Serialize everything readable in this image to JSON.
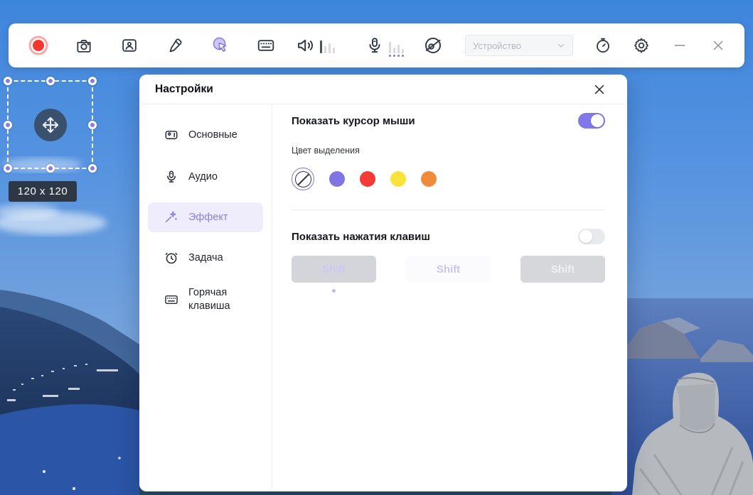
{
  "toolbar": {
    "device_dropdown_value": "Устройство"
  },
  "selection": {
    "size_label": "120 x 120"
  },
  "dialog": {
    "title": "Настройки",
    "sidebar": {
      "items": [
        {
          "label": "Основные"
        },
        {
          "label": "Аудио"
        },
        {
          "label": "Эффект",
          "selected": true
        },
        {
          "label": "Задача"
        },
        {
          "label": "Горячая клавиша"
        }
      ]
    },
    "content": {
      "show_cursor_label": "Показать курсор мыши",
      "show_cursor_enabled": true,
      "highlight_color_label": "Цвет выделения",
      "swatches": [
        {
          "name": "none",
          "selected": true
        },
        {
          "name": "purple",
          "color": "#8075E5"
        },
        {
          "name": "red",
          "color": "#F43B36"
        },
        {
          "name": "yellow",
          "color": "#FBE13C"
        },
        {
          "name": "orange",
          "color": "#F08B3B"
        }
      ],
      "show_keystrokes_label": "Показать нажатия клавиш",
      "show_keystrokes_enabled": false,
      "key_previews": [
        {
          "label": "Shift"
        },
        {
          "label": "Shift"
        },
        {
          "label": "Shift"
        }
      ]
    }
  },
  "colors": {
    "accent": "#8277E8",
    "record_red": "#F5372F",
    "toolbar_icon": "#333A47",
    "selected_sidebar_bg": "#EFEDFB"
  }
}
